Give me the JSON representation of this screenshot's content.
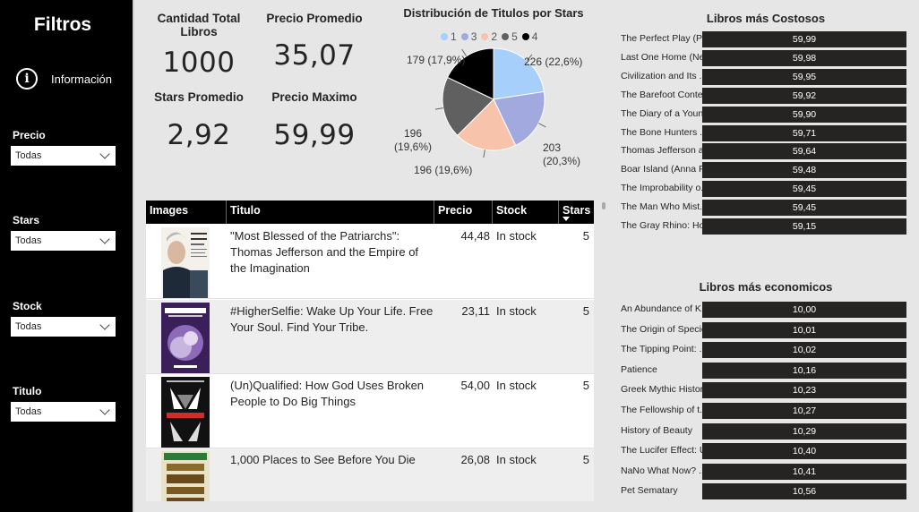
{
  "sidebar": {
    "title": "Filtros",
    "info_label": "Información",
    "filters": [
      {
        "label": "Precio",
        "value": "Todas"
      },
      {
        "label": "Stars",
        "value": "Todas"
      },
      {
        "label": "Stock",
        "value": "Todas"
      },
      {
        "label": "Titulo",
        "value": "Todas"
      }
    ]
  },
  "kpis": {
    "count_label": "Cantidad Total Libros",
    "count_value": "1000",
    "avg_price_label": "Precio Promedio",
    "avg_price_value": "35,07",
    "avg_stars_label": "Stars Promedio",
    "avg_stars_value": "2,92",
    "max_price_label": "Precio Maximo",
    "max_price_value": "59,99"
  },
  "chart_data": {
    "type": "pie",
    "title": "Distribución de Titulos por Stars",
    "legend": [
      {
        "name": "1",
        "color": "#a6cffb"
      },
      {
        "name": "3",
        "color": "#a1a9df"
      },
      {
        "name": "2",
        "color": "#f7c3ab"
      },
      {
        "name": "5",
        "color": "#606060"
      },
      {
        "name": "4",
        "color": "#000000"
      }
    ],
    "slices": [
      {
        "name": "1",
        "value": 226,
        "label": "226 (22,6%)",
        "color": "#a6cffb"
      },
      {
        "name": "3",
        "value": 203,
        "label": "203 (20,3%)",
        "color": "#a1a9df"
      },
      {
        "name": "2",
        "value": 196,
        "label": "196 (19,6%)",
        "color": "#f7c3ab"
      },
      {
        "name": "5",
        "value": 196,
        "label": "196 (19,6%)",
        "color": "#606060"
      },
      {
        "name": "4",
        "value": 179,
        "label": "179 (17,9%)",
        "color": "#000000"
      }
    ]
  },
  "table": {
    "headers": {
      "images": "Images",
      "titulo": "Titulo",
      "precio": "Precio",
      "stock": "Stock",
      "stars": "Stars"
    },
    "rows": [
      {
        "title": "\"Most Blessed of the Patriarchs\": Thomas Jefferson and the Empire of the Imagination",
        "price": "44,48",
        "stock": "In stock",
        "stars": "5",
        "thumb": "book-cover-patriarchs"
      },
      {
        "title": "#HigherSelfie: Wake Up Your Life. Free Your Soul. Find Your Tribe.",
        "price": "23,11",
        "stock": "In stock",
        "stars": "5",
        "thumb": "book-cover-higherselfie"
      },
      {
        "title": "(Un)Qualified: How God Uses Broken People to Do Big Things",
        "price": "54,00",
        "stock": "In stock",
        "stars": "5",
        "thumb": "book-cover-unqualified"
      },
      {
        "title": "1,000 Places to See Before You Die",
        "price": "26,08",
        "stock": "In stock",
        "stars": "5",
        "thumb": "book-cover-1000-places"
      }
    ]
  },
  "costosos": {
    "title": "Libros más Costosos",
    "items": [
      {
        "label": "The Perfect Play (Pl...",
        "value": "59,99"
      },
      {
        "label": "Last One Home (Ne...",
        "value": "59,98"
      },
      {
        "label": "Civilization and Its ...",
        "value": "59,95"
      },
      {
        "label": "The Barefoot Conte...",
        "value": "59,92"
      },
      {
        "label": "The Diary of a Youn...",
        "value": "59,90"
      },
      {
        "label": "The Bone Hunters ...",
        "value": "59,71"
      },
      {
        "label": "Thomas Jefferson a...",
        "value": "59,64"
      },
      {
        "label": "Boar Island (Anna P...",
        "value": "59,48"
      },
      {
        "label": "The Improbability o...",
        "value": "59,45"
      },
      {
        "label": "The Man Who Mist...",
        "value": "59,45"
      },
      {
        "label": "The Gray Rhino: Ho...",
        "value": "59,15"
      }
    ]
  },
  "economicos": {
    "title": "Libros más economicos",
    "items": [
      {
        "label": "An Abundance of K...",
        "value": "10,00"
      },
      {
        "label": "The Origin of Specie...",
        "value": "10,01"
      },
      {
        "label": "The Tipping Point: ...",
        "value": "10,02"
      },
      {
        "label": "Patience",
        "value": "10,16"
      },
      {
        "label": "Greek Mythic History",
        "value": "10,23"
      },
      {
        "label": "The Fellowship of t...",
        "value": "10,27"
      },
      {
        "label": "History of Beauty",
        "value": "10,29"
      },
      {
        "label": "The Lucifer Effect: U...",
        "value": "10,40"
      },
      {
        "label": "NaNo What Now? ...",
        "value": "10,41"
      },
      {
        "label": "Pet Sematary",
        "value": "10,56"
      }
    ]
  }
}
